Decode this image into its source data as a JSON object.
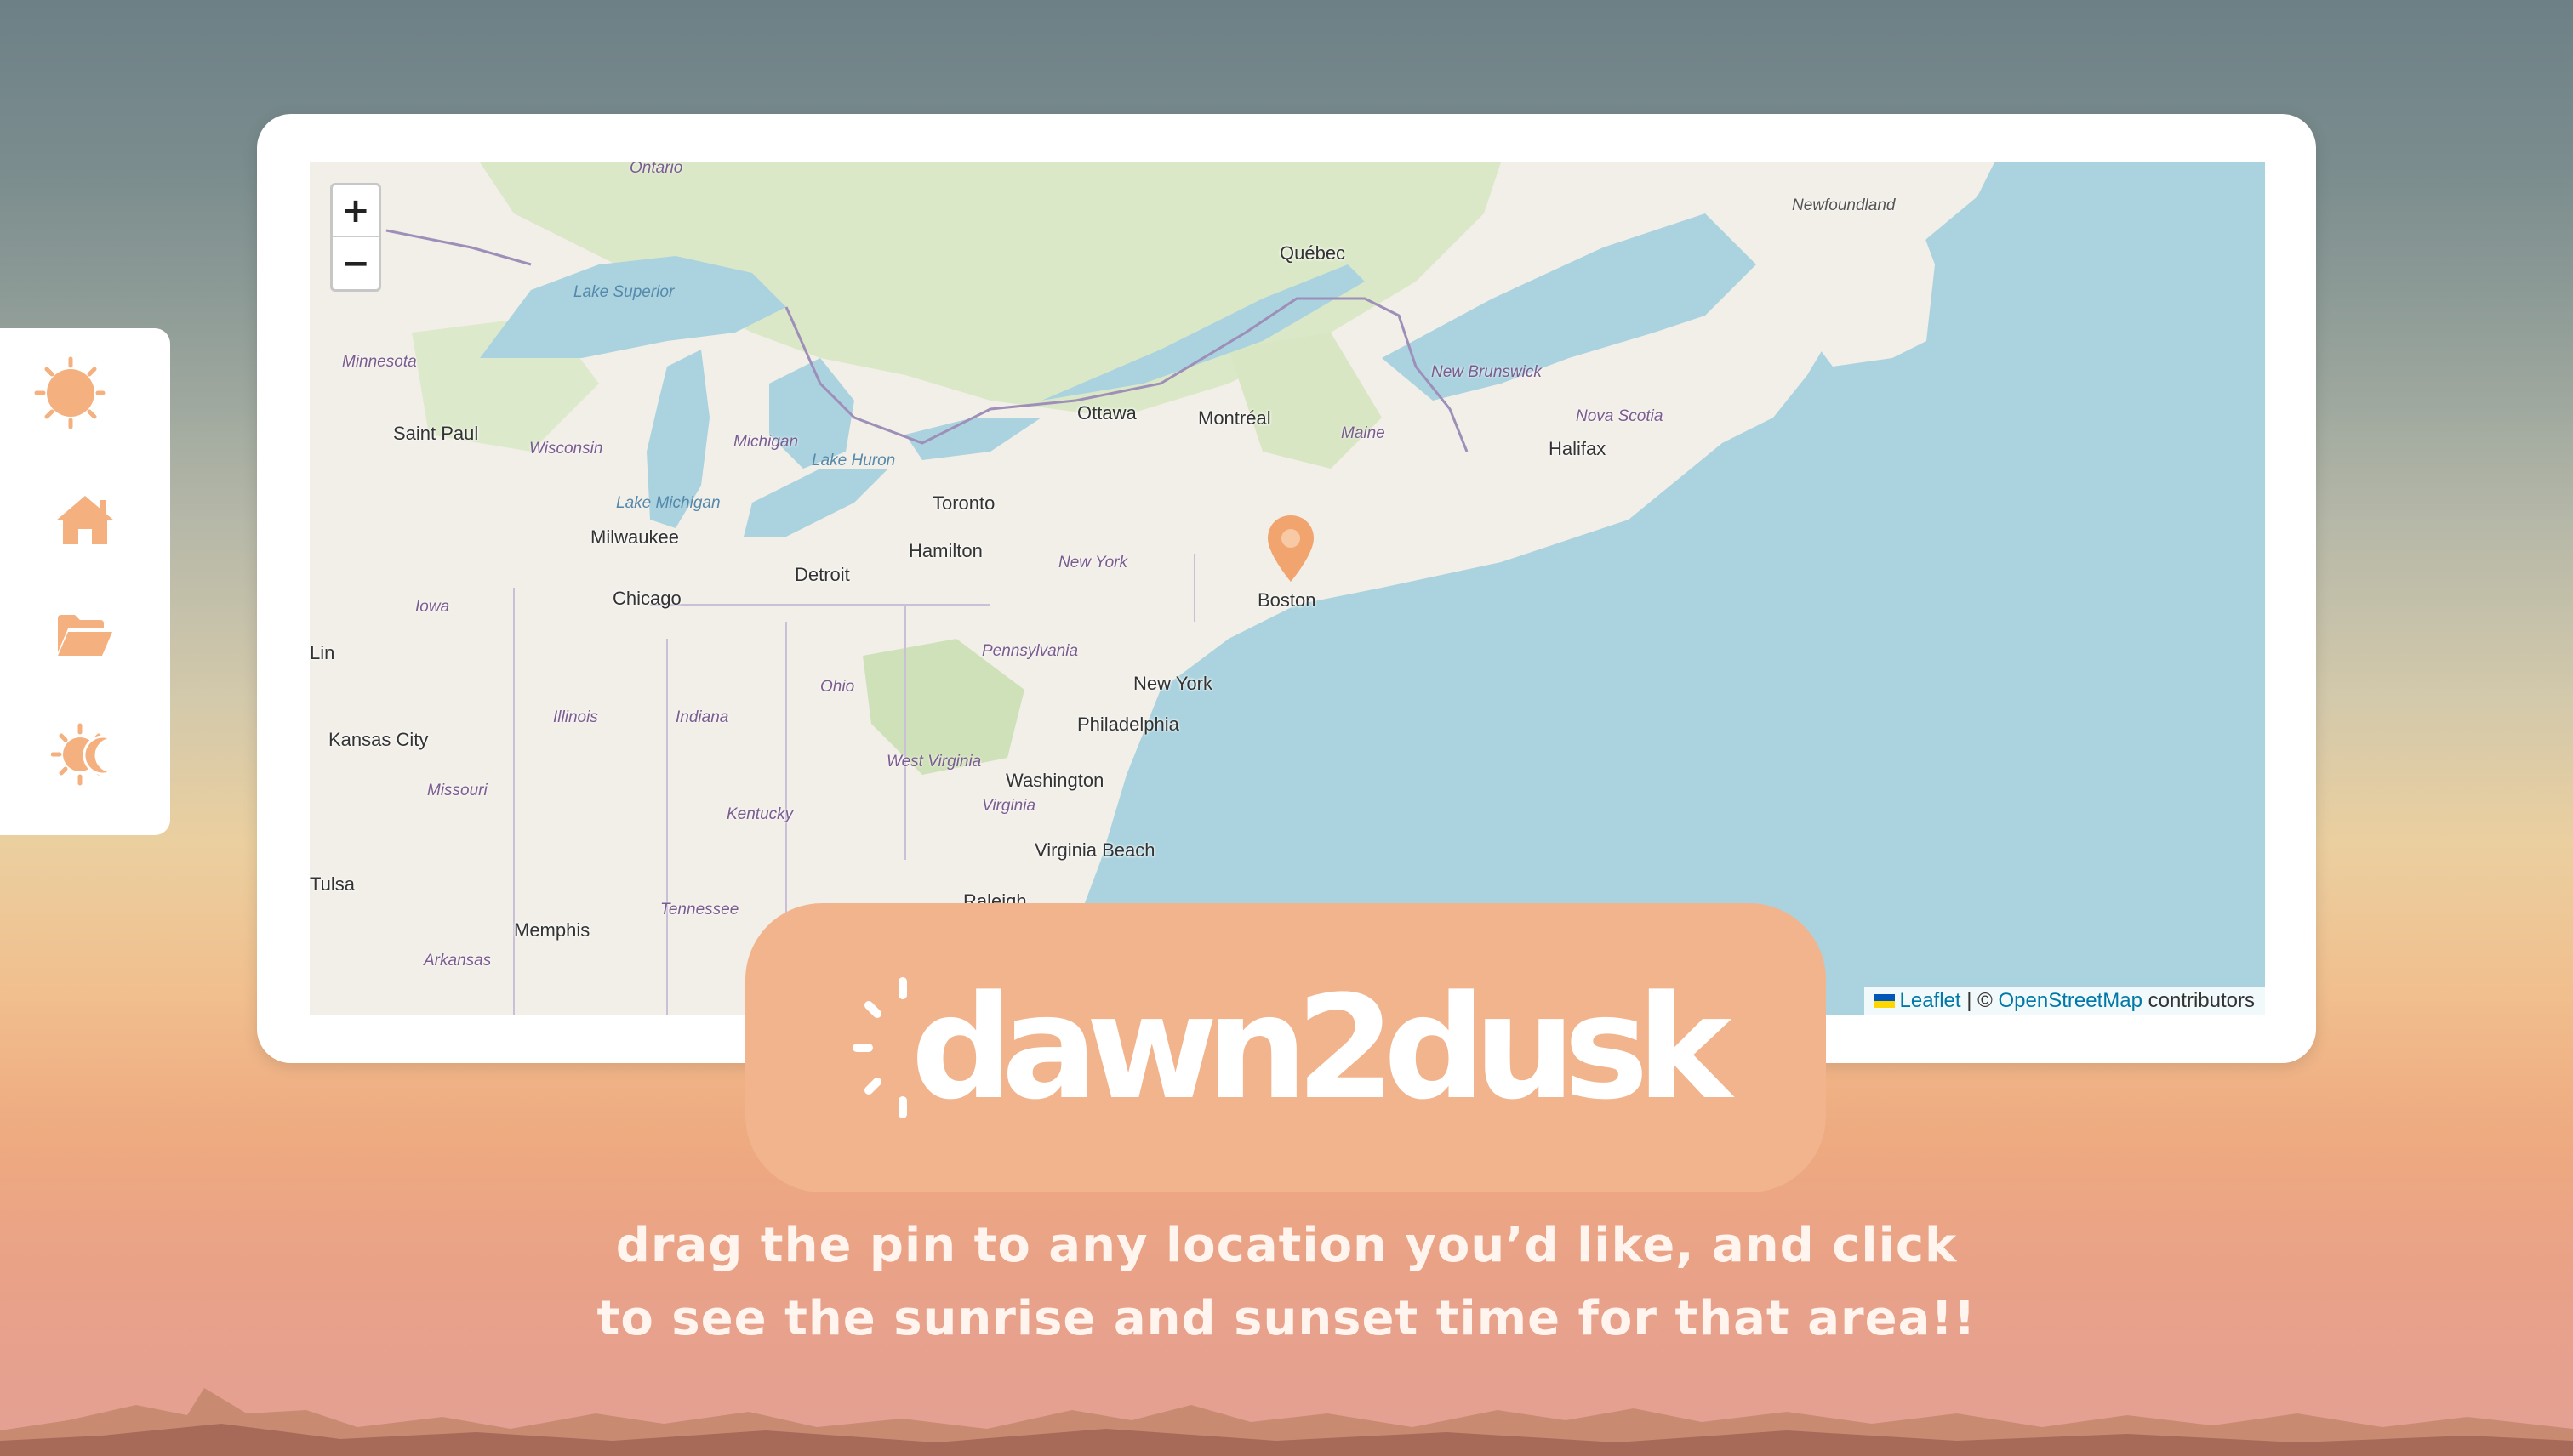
{
  "app": {
    "name": "dawn2dusk"
  },
  "sidebar": {
    "items": [
      {
        "id": "logo",
        "icon": "sun-moon-logo-icon"
      },
      {
        "id": "home",
        "icon": "home-icon"
      },
      {
        "id": "folder",
        "icon": "folder-open-icon"
      },
      {
        "id": "sun-moon",
        "icon": "sun-moon-icon"
      }
    ]
  },
  "map": {
    "zoom_in": "+",
    "zoom_out": "−",
    "attribution": {
      "leaflet": "Leaflet",
      "separator": " | © ",
      "osm": "OpenStreetMap",
      "suffix": " contributors"
    },
    "pin_icon": "location-pin-icon",
    "cities": [
      "Québec",
      "Ottawa",
      "Montréal",
      "Saint Paul",
      "Toronto",
      "Hamilton",
      "Milwaukee",
      "Detroit",
      "Chicago",
      "Boston",
      "New York",
      "Philadelphia",
      "Washington",
      "Kansas City",
      "Virginia Beach",
      "Memphis",
      "Halifax",
      "Raleigh",
      "Tulsa",
      "Lin"
    ],
    "regions": [
      "Newfoundland",
      "New Brunswick",
      "Nova Scotia",
      "Maine",
      "Minnesota",
      "Wisconsin",
      "Michigan",
      "New York",
      "Pennsylvania",
      "Ohio",
      "Iowa",
      "Illinois",
      "Indiana",
      "West Virginia",
      "Virginia",
      "Kentucky",
      "Missouri",
      "Tennessee",
      "Arkansas",
      "Ontario"
    ],
    "waters": [
      "Lake Superior",
      "Lake Michigan",
      "Lake Huron"
    ]
  },
  "colors": {
    "accent": "#f2b48d",
    "sidebar_icon": "#f4b07f",
    "moon": "#3b4a6b"
  },
  "tagline": {
    "line1": "drag the pin to any location you’d like, and click",
    "line2": "to see the sunrise and sunset time for that area!!"
  }
}
